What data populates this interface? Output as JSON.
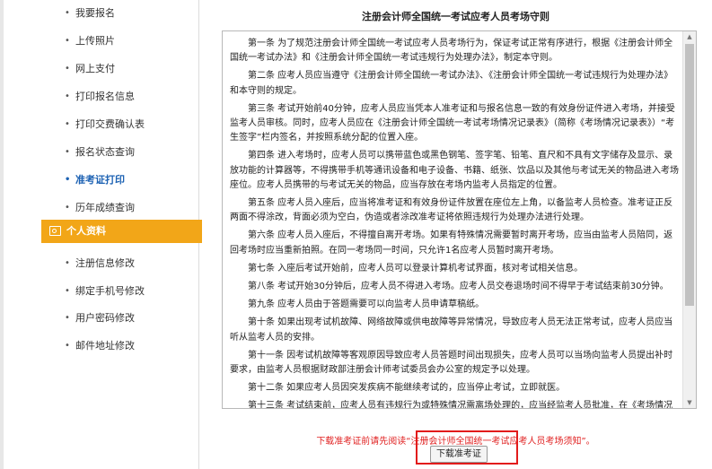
{
  "sidebar": {
    "items_top": [
      {
        "label": "我要报名"
      },
      {
        "label": "上传照片"
      },
      {
        "label": "网上支付"
      },
      {
        "label": "打印报名信息"
      },
      {
        "label": "打印交费确认表"
      },
      {
        "label": "报名状态查询"
      },
      {
        "label": "准考证打印",
        "active": true
      },
      {
        "label": "历年成绩查询"
      }
    ],
    "section": {
      "label": "个人资料",
      "color": "#f2a618"
    },
    "items_bottom": [
      {
        "label": "注册信息修改"
      },
      {
        "label": "绑定手机号修改"
      },
      {
        "label": "用户密码修改"
      },
      {
        "label": "邮件地址修改"
      }
    ],
    "bullet": "•"
  },
  "main": {
    "title": "注册会计师全国统一考试应考人员考场守则",
    "paragraphs": [
      "第一条 为了规范注册会计师全国统一考试应考人员考场行为，保证考试正常有序进行，根据《注册会计师全国统一考试办法》和《注册会计师全国统一考试违规行为处理办法》，制定本守则。",
      "第二条 应考人员应当遵守《注册会计师全国统一考试办法》、《注册会计师全国统一考试违规行为处理办法》和本守则的规定。",
      "第三条 考试开始前40分钟，应考人员应当凭本人准考证和与报名信息一致的有效身份证件进入考场，并接受监考人员审核。同时，应考人员应在《注册会计师全国统一考试考场情况记录表》（简称《考场情况记录表》）“考生签字”栏内签名，并按照系统分配的位置入座。",
      "第四条 进入考场时，应考人员可以携带蓝色或黑色钢笔、签字笔、铅笔、直尺和不具有文字储存及显示、录放功能的计算器等，不得携带手机等通讯设备和电子设备、书籍、纸张、饮品以及其他与考试无关的物品进入考场座位。应考人员携带的与考试无关的物品，应当存放在考场内监考人员指定的位置。",
      "第五条 应考人员入座后，应当将准考证和有效身份证件放置在座位左上角，以备监考人员检查。准考证正反两面不得涂改，背面必须为空白，伪造或者涂改准考证将依照违规行为处理办法进行处理。",
      "第六条 应考人员入座后，不得擅自离开考场。如果有特殊情况需要暂时离开考场，应当由监考人员陪同，返回考场时应当重新拍照。在同一考场同一时间，只允许1名应考人员暂时离开考场。",
      "第七条 入座后考试开始前，应考人员可以登录计算机考试界面，核对考试相关信息。",
      "第八条 考试开始30分钟后，应考人员不得进入考场。应考人员交卷退场时间不得早于考试结束前30分钟。",
      "第九条 应考人员由于答题需要可以向监考人员申请草稿纸。",
      "第十条 如果出现考试机故障、网络故障或供电故障等异常情况，导致应考人员无法正常考试，应考人员应当听从监考人员的安排。",
      "第十一条 因考试机故障等客观原因导致应考人员答题时间出现损失，应考人员可以当场向监考人员提出补时要求，由监考人员根据财政部注册会计师考试委员会办公室的规定予以处理。",
      "第十二条 如果应考人员因突发疾病不能继续考试的，应当停止考试，立即就医。",
      "第十三条 考试结束前，应考人员有违规行为或特殊情况需离场处理的，应当经监考人员批准，在《考场情况记录表》上签字确认后离开考场。"
    ],
    "notice": "下载准考证前请先阅读“注册会计师全国统一考试应考人员考场须知”。",
    "download_button": "下载准考证",
    "notice_color": "#e02020",
    "highlight_color": "#e21b1b"
  }
}
